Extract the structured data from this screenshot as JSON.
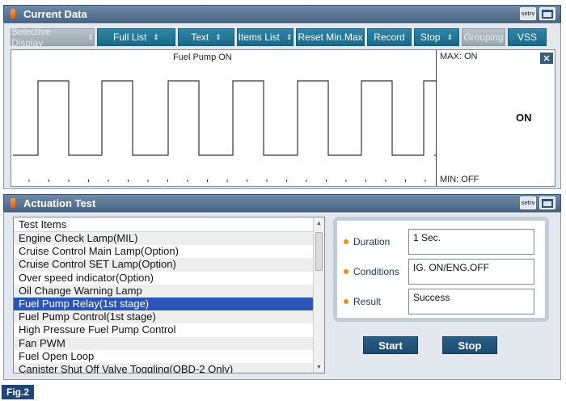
{
  "current_data": {
    "title": "Current Data",
    "toolbar": [
      {
        "label": "Selective Display",
        "arrow": true,
        "disabled": true,
        "width": 104
      },
      {
        "label": "Full List",
        "arrow": true,
        "disabled": false,
        "width": 97
      },
      {
        "label": "Text",
        "arrow": true,
        "disabled": false,
        "width": 70
      },
      {
        "label": "Items List",
        "arrow": true,
        "disabled": false,
        "width": 70
      },
      {
        "label": "Reset Min.Max",
        "arrow": false,
        "disabled": false,
        "width": 85
      },
      {
        "label": "Record",
        "arrow": false,
        "disabled": false,
        "width": 55
      },
      {
        "label": "Stop",
        "arrow": true,
        "disabled": false,
        "width": 56
      },
      {
        "label": "Grouping",
        "arrow": false,
        "disabled": true,
        "width": 54
      },
      {
        "label": "VSS",
        "arrow": false,
        "disabled": false,
        "width": 48
      }
    ],
    "graph": {
      "title": "Fuel Pump ON",
      "max_label": "MAX: ON",
      "min_label": "MIN: OFF",
      "current_value": "ON",
      "close_symbol": "✕"
    }
  },
  "actuation_test": {
    "title": "Actuation Test",
    "list_header": "Test Items",
    "items": [
      "Engine Check Lamp(MIL)",
      "Cruise Control Main Lamp(Option)",
      "Cruise Control SET Lamp(Option)",
      "Over speed indicator(Option)",
      "Oil Change Warning Lamp",
      "Fuel Pump Relay(1st stage)",
      "Fuel Pump Control(1st stage)",
      "High Pressure Fuel Pump Control",
      "Fan PWM",
      "Fuel Open Loop",
      "Canister Shut Off Valve Toggling(OBD-2 Only)"
    ],
    "selected_index": 5,
    "duration_label": "Duration",
    "duration_value": "1 Sec.",
    "conditions_label": "Conditions",
    "conditions_value": "IG. ON/ENG.OFF",
    "result_label": "Result",
    "result_value": "Success",
    "start_label": "Start",
    "stop_label": "Stop"
  },
  "header_icon_text": "setrv",
  "figure_label": "Fig.2",
  "colors": {
    "accent": "#1b6788",
    "selected": "#2a55b4",
    "header": "#4a6685"
  }
}
